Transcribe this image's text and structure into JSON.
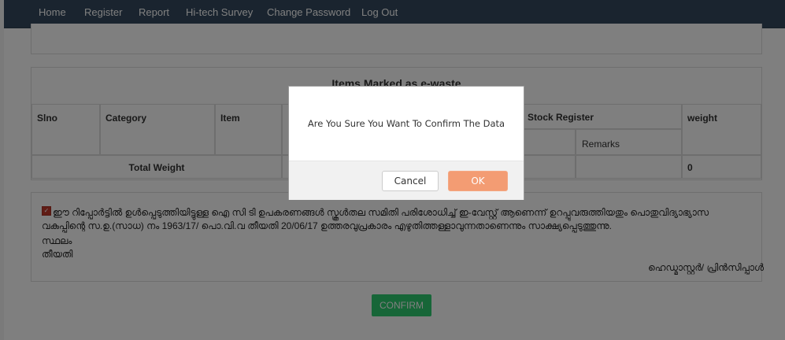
{
  "nav": {
    "items": [
      "Home",
      "Register",
      "Report",
      "Hi-tech Survey",
      "Change Password",
      "Log Out"
    ]
  },
  "items_section": {
    "title": "Items Marked as e-waste",
    "headers": {
      "slno": "Slno",
      "category": "Category",
      "item": "Item",
      "stock_register": "Stock Register",
      "weight": "weight",
      "remarks": "Remarks"
    },
    "total_label": "Total Weight",
    "total_value": "0"
  },
  "declaration": {
    "checked": true,
    "text": "ഈ റിപ്പോർട്ടിൽ ഉൾപ്പെടുത്തിയിട്ടുള്ള ഐ സി ടി ഉപകരണങ്ങൾ സ്കൂൾതല സമിതി പരിശോധിച്ച് ഇ-വേസ്റ്റ് ആണെന്ന് ഉറപ്പുവരുത്തിയതും പൊതുവിദ്യാഭ്യാസ വകുപ്പിന്റെ സ.ഉ.(സാധ) നം 1963/17/ പൊ.വി.വ തീയതി 20/06/17 ഉത്തരവുപ്രകാരം എഴുതിത്തള്ളാവുന്നതാണെന്നും സാക്ഷ്യപ്പെടുത്തുന്നു.",
    "place_label": "സ്ഥലം",
    "date_label": "തീയതി",
    "signature_label": "ഹെഡ്മാസ്റ്റർ/ പ്രിൻസിപ്പാൾ"
  },
  "confirm_label": "CONFIRM",
  "modal": {
    "message": "Are You Sure You Want To Confirm The Data",
    "cancel_label": "Cancel",
    "ok_label": "OK"
  },
  "colors": {
    "navbar": "#34495e",
    "confirm": "#2ecc71",
    "ok": "#f39c73"
  }
}
